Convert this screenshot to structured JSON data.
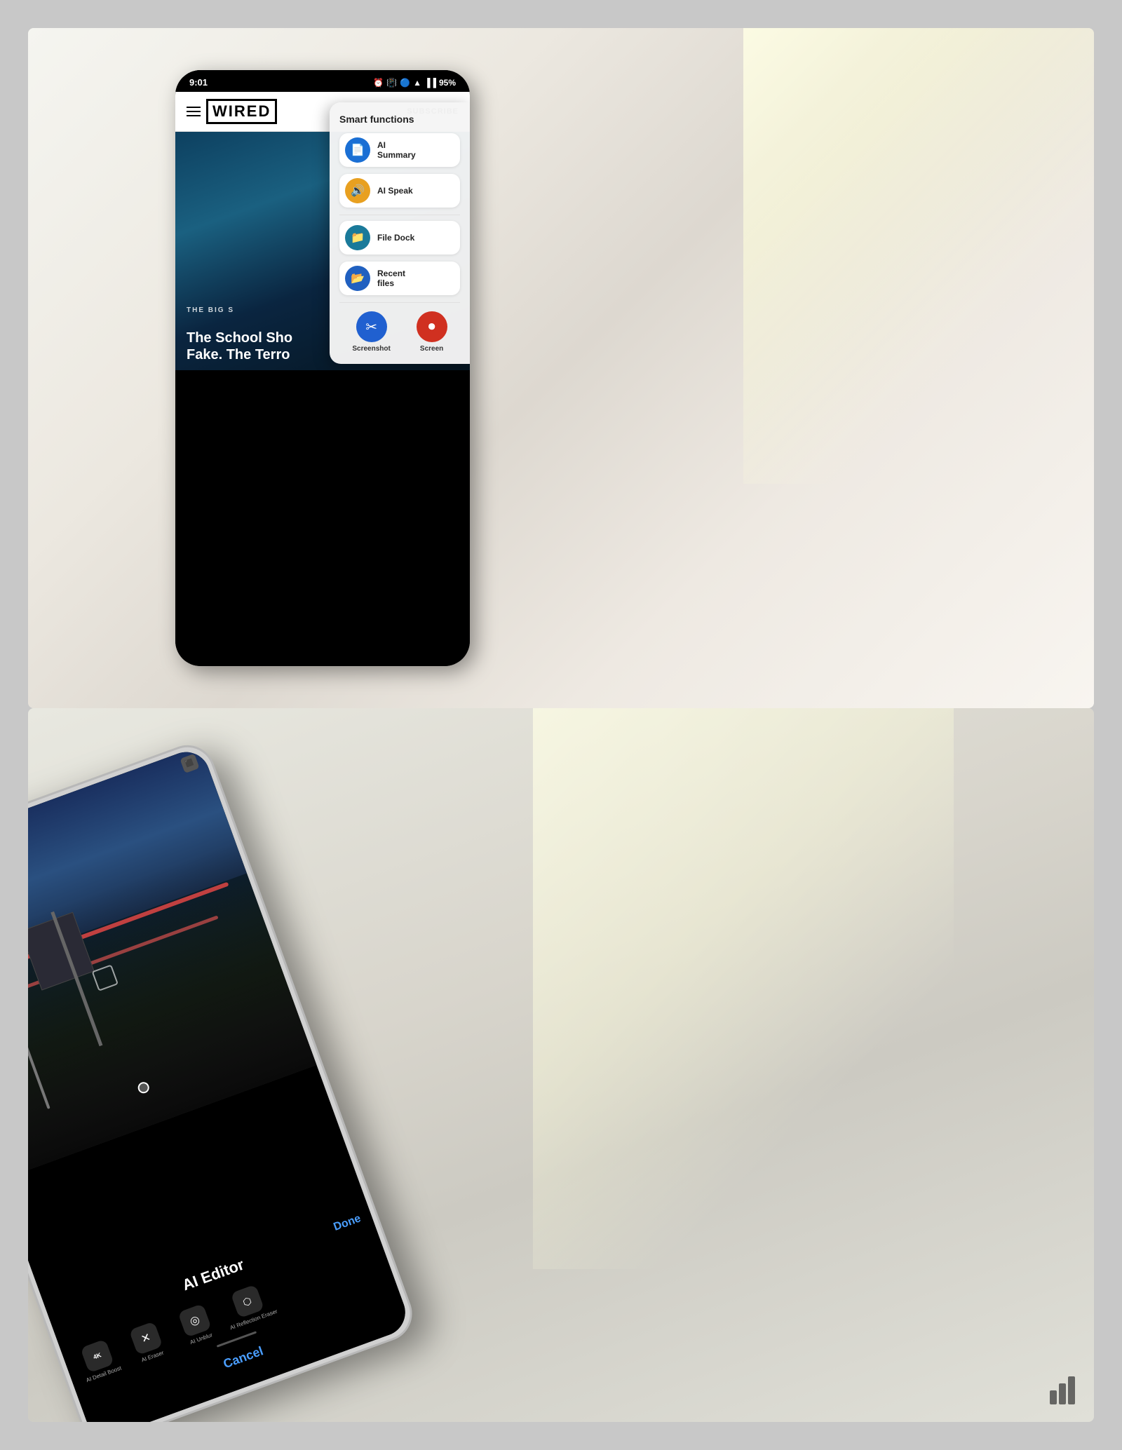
{
  "page": {
    "background_color": "#c8c8c8"
  },
  "top_photo": {
    "phone": {
      "status_bar": {
        "time": "9:01",
        "battery": "95%",
        "icons": [
          "notification",
          "alarm",
          "bluetooth",
          "wifi",
          "signal"
        ]
      },
      "header": {
        "menu_icon": "☰",
        "logo": "WIRED",
        "subscribe": "SUBSCRIBE"
      },
      "article": {
        "label": "THE BIG S",
        "headline_line1": "The School Sho",
        "headline_line2": "Fake. The Terro"
      },
      "smart_panel": {
        "title": "Smart functions",
        "items": [
          {
            "icon": "📋",
            "label": "AI Summary",
            "color": "blue"
          },
          {
            "icon": "🔊",
            "label": "AI Speak",
            "color": "gold"
          },
          {
            "icon": "📁",
            "label": "File Dock",
            "color": "teal"
          },
          {
            "icon": "📂",
            "label": "Recent files",
            "color": "blue2"
          }
        ]
      },
      "bottom_toolbar": {
        "items": [
          {
            "icon": "✂",
            "label": "Screenshot",
            "color": "blue"
          },
          {
            "icon": "⏺",
            "label": "Screen",
            "color": "red"
          }
        ]
      }
    }
  },
  "bottom_photo": {
    "phone": {
      "ai_editor": {
        "title": "AI Editor",
        "done_label": "Done",
        "cancel_label": "Cancel",
        "tools": [
          {
            "icon": "4K",
            "label": "AI Detail Boost"
          },
          {
            "icon": "✗",
            "label": "AI Eraser"
          },
          {
            "icon": "◎",
            "label": "AI Unblur"
          },
          {
            "icon": "⬡",
            "label": "AI Reflection Eraser"
          }
        ]
      }
    }
  },
  "watermark": {
    "label": "WIRED logo bars"
  }
}
